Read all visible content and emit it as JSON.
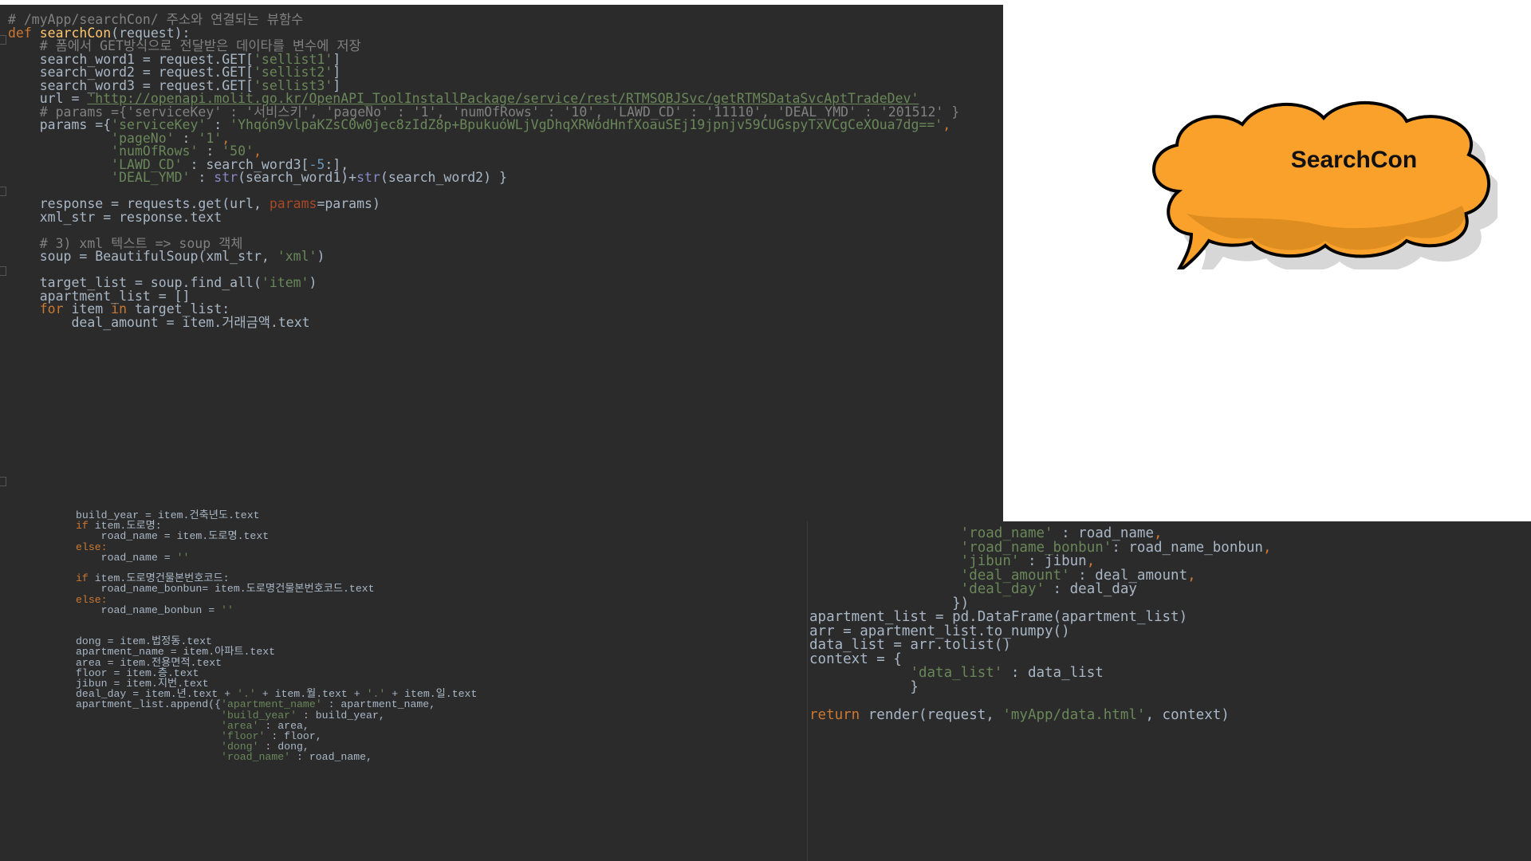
{
  "editor_top": {
    "lines": [
      {
        "parts": [
          {
            "t": "# /myApp/searchCon/ 주소와 연결되는 뷰함수",
            "c": "c"
          }
        ]
      },
      {
        "parts": [
          {
            "t": "def ",
            "c": "k"
          },
          {
            "t": "searchCon",
            "c": "fn"
          },
          {
            "t": "(request):"
          }
        ]
      },
      {
        "parts": [
          {
            "t": "    # 폼에서 GET방식으로 전달받은 데이타를 변수에 저장",
            "c": "c"
          }
        ]
      },
      {
        "parts": [
          {
            "t": "    search_word1 = request.GET["
          },
          {
            "t": "'sellist1'",
            "c": "s"
          },
          {
            "t": "]"
          }
        ]
      },
      {
        "parts": [
          {
            "t": "    search_word2 = request.GET["
          },
          {
            "t": "'sellist2'",
            "c": "s"
          },
          {
            "t": "]"
          }
        ]
      },
      {
        "parts": [
          {
            "t": "    search_word3 = request.GET["
          },
          {
            "t": "'sellist3'",
            "c": "s"
          },
          {
            "t": "]"
          }
        ]
      },
      {
        "parts": [
          {
            "t": "    url = "
          },
          {
            "t": "'http://openapi.molit.go.kr/OpenAPI_ToolInstallPackage/service/rest/RTMSOBJSvc/getRTMSDataSvcAptTradeDev'",
            "c": "s u"
          }
        ]
      },
      {
        "parts": [
          {
            "t": "    # params ={'serviceKey' : '서비스키', 'pageNo' : '1', 'numOfRows' : '10', 'LAWD_CD' : '11110', 'DEAL_YMD' : '201512' }",
            "c": "c"
          }
        ]
      },
      {
        "parts": [
          {
            "t": "    params ={"
          },
          {
            "t": "'serviceKey'",
            "c": "s"
          },
          {
            "t": " : "
          },
          {
            "t": "'Yhqón9vlpaKZsC0w0jec8zIdZ8p+BpukuóWLjVgDhqXRWódHnfXoauSEj19jpnjv59CUGspyTxVCgCeXOua7dg=='",
            "c": "s"
          },
          {
            "t": ",",
            "c": "k"
          }
        ]
      },
      {
        "parts": [
          {
            "t": "             "
          },
          {
            "t": "'pageNo'",
            "c": "s"
          },
          {
            "t": " : "
          },
          {
            "t": "'1'",
            "c": "s"
          },
          {
            "t": ",",
            "c": "k"
          }
        ]
      },
      {
        "parts": [
          {
            "t": "             "
          },
          {
            "t": "'numOfRows'",
            "c": "s"
          },
          {
            "t": " : "
          },
          {
            "t": "'50'",
            "c": "s"
          },
          {
            "t": ",",
            "c": "k"
          }
        ]
      },
      {
        "parts": [
          {
            "t": "             "
          },
          {
            "t": "'LAWD_CD'",
            "c": "s"
          },
          {
            "t": " : search_word3["
          },
          {
            "t": "-5",
            "c": "n"
          },
          {
            "t": ":],"
          }
        ]
      },
      {
        "parts": [
          {
            "t": "             "
          },
          {
            "t": "'DEAL_YMD'",
            "c": "s"
          },
          {
            "t": " : "
          },
          {
            "t": "str",
            "c": "b"
          },
          {
            "t": "(search_word1)+"
          },
          {
            "t": "str",
            "c": "b"
          },
          {
            "t": "(search_word2) }"
          }
        ]
      },
      {
        "parts": [
          {
            "t": ""
          }
        ]
      },
      {
        "parts": [
          {
            "t": "    response = requests.get(url, "
          },
          {
            "t": "params",
            "c": "p"
          },
          {
            "t": "=params)"
          }
        ]
      },
      {
        "parts": [
          {
            "t": "    xml_str = response.text"
          }
        ]
      },
      {
        "parts": [
          {
            "t": ""
          }
        ]
      },
      {
        "parts": [
          {
            "t": "    # 3) xml 텍스트 => soup 객체",
            "c": "c"
          }
        ]
      },
      {
        "parts": [
          {
            "t": "    soup = BeautifulSoup(xml_str, "
          },
          {
            "t": "'xml'",
            "c": "s"
          },
          {
            "t": ")"
          }
        ]
      },
      {
        "parts": [
          {
            "t": ""
          }
        ]
      },
      {
        "parts": [
          {
            "t": "    target_list = soup.find_all("
          },
          {
            "t": "'item'",
            "c": "s"
          },
          {
            "t": ")"
          }
        ]
      },
      {
        "parts": [
          {
            "t": "    apartment_list = []"
          }
        ]
      },
      {
        "parts": [
          {
            "t": "    "
          },
          {
            "t": "for ",
            "c": "k"
          },
          {
            "t": "item "
          },
          {
            "t": "in ",
            "c": "k"
          },
          {
            "t": "target_list:"
          }
        ]
      },
      {
        "parts": [
          {
            "t": "        deal_amount = item.거래금액.text"
          }
        ]
      }
    ]
  },
  "editor_bottom_left": {
    "lines": [
      {
        "parts": [
          {
            "t": "build_year = item.건축년도.text"
          }
        ]
      },
      {
        "parts": [
          {
            "t": "if ",
            "c": "k"
          },
          {
            "t": "item.도로명:"
          }
        ]
      },
      {
        "parts": [
          {
            "t": "    road_name = item.도로명.text"
          }
        ]
      },
      {
        "parts": [
          {
            "t": "else:",
            "c": "k"
          }
        ]
      },
      {
        "parts": [
          {
            "t": "    road_name = "
          },
          {
            "t": "''",
            "c": "s"
          }
        ]
      },
      {
        "parts": [
          {
            "t": ""
          }
        ]
      },
      {
        "parts": [
          {
            "t": "if ",
            "c": "k"
          },
          {
            "t": "item.도로명건물본번호코드:"
          }
        ]
      },
      {
        "parts": [
          {
            "t": "    road_name_bonbun= item.도로명건물본번호코드.text"
          }
        ]
      },
      {
        "parts": [
          {
            "t": "else:",
            "c": "k"
          }
        ]
      },
      {
        "parts": [
          {
            "t": "    road_name_bonbun = "
          },
          {
            "t": "''",
            "c": "s"
          }
        ]
      },
      {
        "parts": [
          {
            "t": ""
          }
        ]
      },
      {
        "parts": [
          {
            "t": ""
          }
        ]
      },
      {
        "parts": [
          {
            "t": "dong = item.법정동.text"
          }
        ]
      },
      {
        "parts": [
          {
            "t": "apartment_name = item.아파트.text"
          }
        ]
      },
      {
        "parts": [
          {
            "t": "area = item.전용면적.text"
          }
        ]
      },
      {
        "parts": [
          {
            "t": "floor = item.층.text"
          }
        ]
      },
      {
        "parts": [
          {
            "t": "jibun = item.지번.text"
          }
        ]
      },
      {
        "parts": [
          {
            "t": "deal_day = item.년.text + "
          },
          {
            "t": "'.'",
            "c": "s"
          },
          {
            "t": " + item.월.text + "
          },
          {
            "t": "'.'",
            "c": "s"
          },
          {
            "t": " + item.일.text"
          }
        ]
      },
      {
        "parts": [
          {
            "t": "apartment_list.append({"
          },
          {
            "t": "'apartment_name'",
            "c": "s"
          },
          {
            "t": " : apartment_name,"
          }
        ]
      },
      {
        "parts": [
          {
            "t": "                       "
          },
          {
            "t": "'build_year'",
            "c": "s"
          },
          {
            "t": " : build_year,"
          }
        ]
      },
      {
        "parts": [
          {
            "t": "                       "
          },
          {
            "t": "'area'",
            "c": "s"
          },
          {
            "t": " : area,"
          }
        ]
      },
      {
        "parts": [
          {
            "t": "                       "
          },
          {
            "t": "'floor'",
            "c": "s"
          },
          {
            "t": " : floor,"
          }
        ]
      },
      {
        "parts": [
          {
            "t": "                       "
          },
          {
            "t": "'dong'",
            "c": "s"
          },
          {
            "t": " : dong,"
          }
        ]
      },
      {
        "parts": [
          {
            "t": "                       "
          },
          {
            "t": "'road_name'",
            "c": "s"
          },
          {
            "t": " : road_name,"
          }
        ]
      }
    ]
  },
  "editor_bottom_right": {
    "lines": [
      {
        "parts": [
          {
            "t": "                  "
          },
          {
            "t": "'road_name'",
            "c": "s"
          },
          {
            "t": " : road_name"
          },
          {
            "t": ",",
            "c": "k"
          }
        ]
      },
      {
        "parts": [
          {
            "t": "                  "
          },
          {
            "t": "'road_name_bonbun'",
            "c": "s"
          },
          {
            "t": ": road_name_bonbun"
          },
          {
            "t": ",",
            "c": "k"
          }
        ]
      },
      {
        "parts": [
          {
            "t": "                  "
          },
          {
            "t": "'jibun'",
            "c": "s"
          },
          {
            "t": " : jibun"
          },
          {
            "t": ",",
            "c": "k"
          }
        ]
      },
      {
        "parts": [
          {
            "t": "                  "
          },
          {
            "t": "'deal_amount'",
            "c": "s"
          },
          {
            "t": " : deal_amount"
          },
          {
            "t": ",",
            "c": "k"
          }
        ]
      },
      {
        "parts": [
          {
            "t": "                  "
          },
          {
            "t": "'deal_day'",
            "c": "s"
          },
          {
            "t": " : deal_day"
          }
        ]
      },
      {
        "parts": [
          {
            "t": "                 })"
          }
        ]
      },
      {
        "parts": [
          {
            "t": "apartment_list = pd.DataFrame(apartment_list)"
          }
        ]
      },
      {
        "parts": [
          {
            "t": "arr = apartment_list.to_numpy()"
          }
        ]
      },
      {
        "parts": [
          {
            "t": "data_list = arr.tolist()"
          }
        ]
      },
      {
        "parts": [
          {
            "t": "context = {"
          }
        ]
      },
      {
        "parts": [
          {
            "t": "            "
          },
          {
            "t": "'data_list'",
            "c": "s"
          },
          {
            "t": " : data_list"
          }
        ]
      },
      {
        "parts": [
          {
            "t": "            }"
          }
        ]
      },
      {
        "parts": [
          {
            "t": ""
          }
        ]
      },
      {
        "parts": [
          {
            "t": "return ",
            "c": "k"
          },
          {
            "t": "render(request, "
          },
          {
            "t": "'myApp/data.html'",
            "c": "s"
          },
          {
            "t": ", context)"
          }
        ]
      }
    ]
  },
  "callout": {
    "label": "SearchCon",
    "fill_color": "#f9a12b",
    "shade_color": "#d98a1f"
  }
}
